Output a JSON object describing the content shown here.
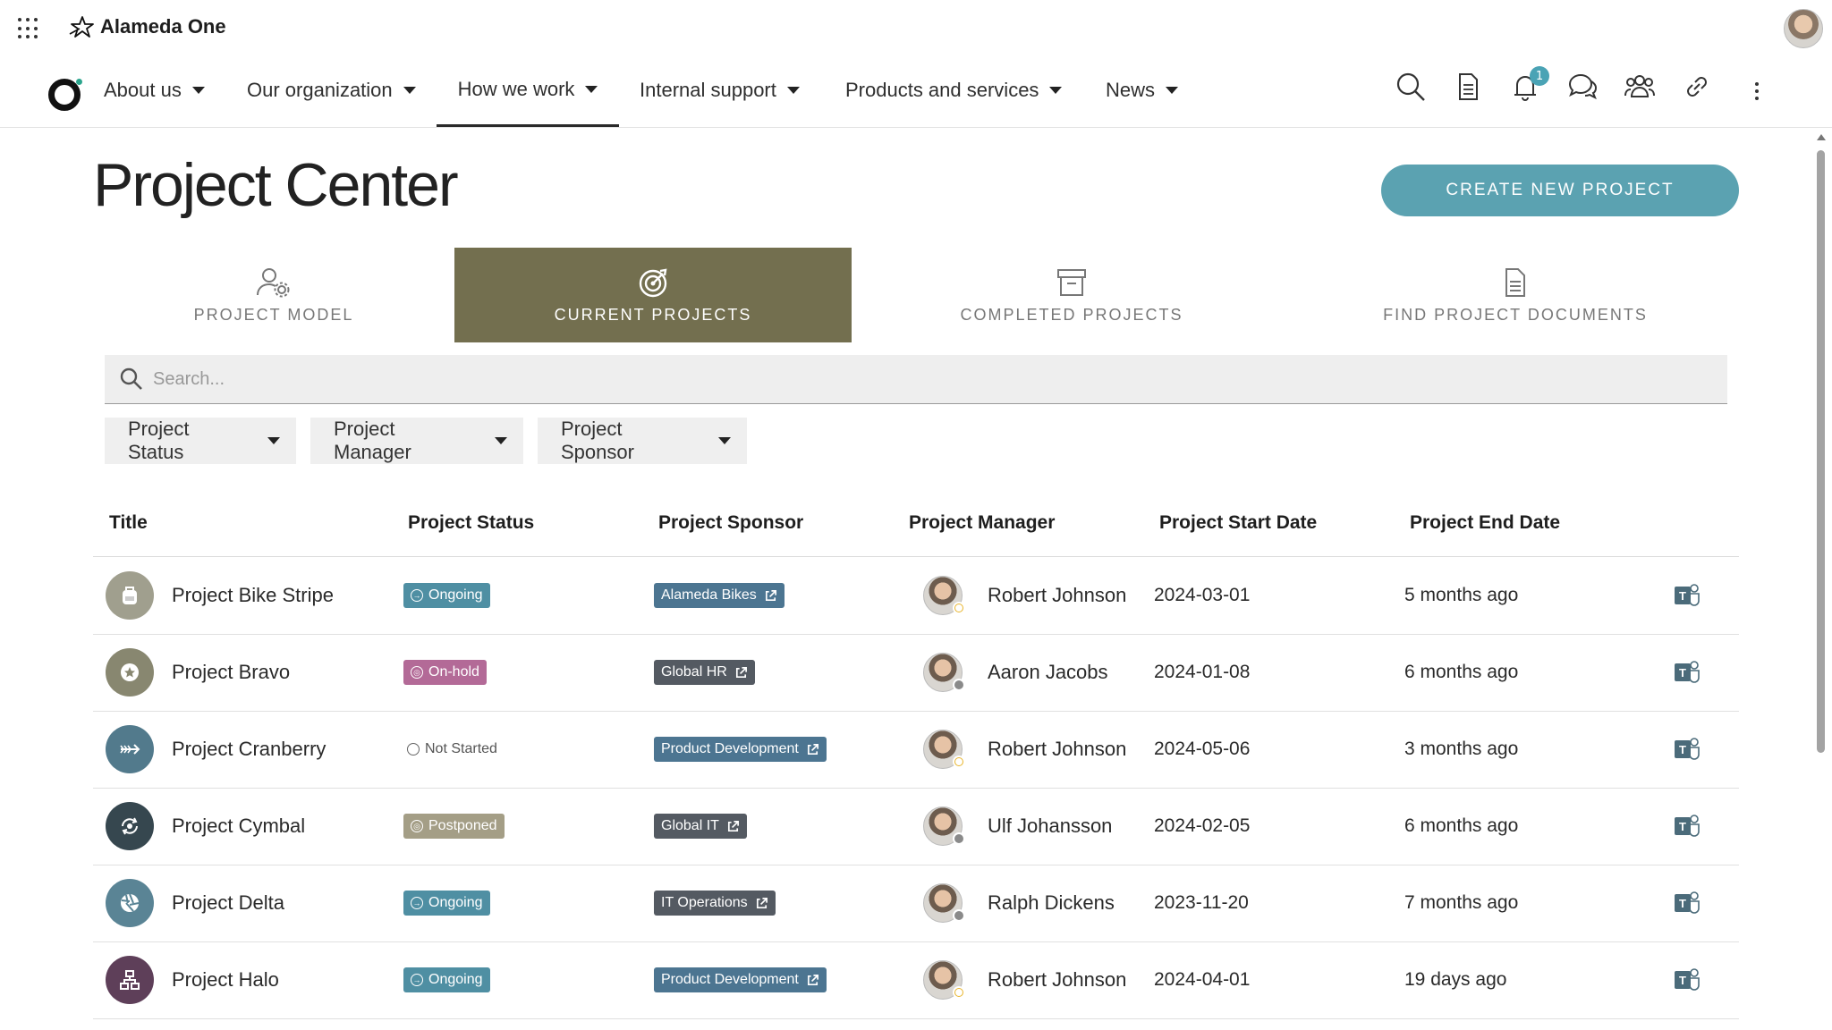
{
  "app": {
    "name": "Alameda One"
  },
  "nav": {
    "items": [
      {
        "label": "About us"
      },
      {
        "label": "Our organization"
      },
      {
        "label": "How we work"
      },
      {
        "label": "Internal support"
      },
      {
        "label": "Products and services"
      },
      {
        "label": "News"
      }
    ],
    "active_index": 2,
    "notification_count": "1",
    "icons": [
      "search-icon",
      "document-icon",
      "bell-icon",
      "chat-icon",
      "people-icon",
      "link-icon",
      "more-vertical-icon"
    ]
  },
  "page": {
    "title": "Project Center",
    "create_button": "CREATE NEW PROJECT"
  },
  "tabs": [
    {
      "label": "PROJECT MODEL",
      "icon": "user-settings-icon"
    },
    {
      "label": "CURRENT PROJECTS",
      "icon": "target-icon",
      "active": true
    },
    {
      "label": "COMPLETED PROJECTS",
      "icon": "archive-icon"
    },
    {
      "label": "FIND PROJECT DOCUMENTS",
      "icon": "document-icon"
    }
  ],
  "search": {
    "placeholder": "Search..."
  },
  "filters": [
    {
      "label": "Project Status"
    },
    {
      "label": "Project Manager"
    },
    {
      "label": "Project Sponsor"
    }
  ],
  "table": {
    "columns": [
      "Title",
      "Project Status",
      "Project Sponsor",
      "Project Manager",
      "Project Start Date",
      "Project End Date"
    ],
    "rows": [
      {
        "title": "Project Bike Stripe",
        "status": "Ongoing",
        "status_color": "#4f8fa3",
        "sponsor": "Alameda Bikes",
        "sponsor_color": "#4c7591",
        "manager": "Robert Johnson",
        "presence": "away",
        "start": "2024-03-01",
        "end": "5 months ago",
        "icon_color": "#a09f8e",
        "icon": "backpack-icon"
      },
      {
        "title": "Project Bravo",
        "status": "On-hold",
        "status_color": "#b36a97",
        "sponsor": "Global HR",
        "sponsor_color": "#545a62",
        "manager": "Aaron Jacobs",
        "presence": "offline",
        "start": "2024-01-08",
        "end": "6 months ago",
        "icon_color": "#888770",
        "icon": "star-icon"
      },
      {
        "title": "Project Cranberry",
        "status": "Not Started",
        "status_color": "",
        "sponsor": "Product Development",
        "sponsor_color": "#4c7591",
        "manager": "Robert Johnson",
        "presence": "away",
        "start": "2024-05-06",
        "end": "3 months ago",
        "icon_color": "#527a8c",
        "icon": "arrow-icon"
      },
      {
        "title": "Project Cymbal",
        "status": "Postponed",
        "status_color": "#a49e86",
        "sponsor": "Global IT",
        "sponsor_color": "#545a62",
        "manager": "Ulf Johansson",
        "presence": "offline",
        "start": "2024-02-05",
        "end": "6 months ago",
        "icon_color": "#36474f",
        "icon": "cycle-icon"
      },
      {
        "title": "Project Delta",
        "status": "Ongoing",
        "status_color": "#4f8fa3",
        "sponsor": "IT Operations",
        "sponsor_color": "#545a62",
        "manager": "Ralph Dickens",
        "presence": "offline",
        "start": "2023-11-20",
        "end": "7 months ago",
        "icon_color": "#5a8495",
        "icon": "aperture-icon"
      },
      {
        "title": "Project Halo",
        "status": "Ongoing",
        "status_color": "#4f8fa3",
        "sponsor": "Product Development",
        "sponsor_color": "#4c7591",
        "manager": "Robert Johnson",
        "presence": "away",
        "start": "2024-04-01",
        "end": "19 days ago",
        "icon_color": "#5e3f59",
        "icon": "network-icon"
      }
    ]
  },
  "colors": {
    "accent_teal": "#5ba2b1",
    "active_tab": "#736f4f",
    "presence_away": "#e8b42a",
    "presence_offline": "#8a8a8a"
  }
}
